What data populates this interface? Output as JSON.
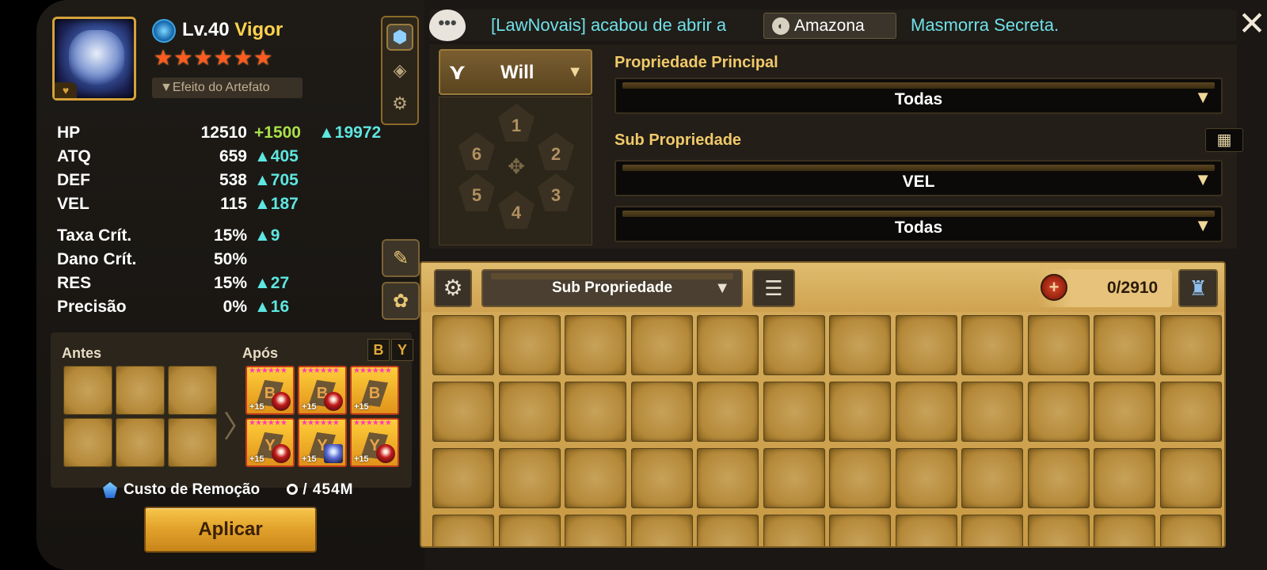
{
  "monster": {
    "level": "Lv.40",
    "name": "Vigor",
    "stars": "★★★★★★",
    "artifact_effect_label": "▼Efeito do Artefato"
  },
  "stats": [
    {
      "label": "HP",
      "base": "12510",
      "bonus": "+1500",
      "bonus2": "▲19972"
    },
    {
      "label": "ATQ",
      "base": "659",
      "bonus": "▲405"
    },
    {
      "label": "DEF",
      "base": "538",
      "bonus": "▲705"
    },
    {
      "label": "VEL",
      "base": "115",
      "bonus": "▲187"
    },
    {
      "label": "Taxa Crít.",
      "base": "15%",
      "bonus": "▲9"
    },
    {
      "label": "Dano Crít.",
      "base": "50%",
      "bonus": ""
    },
    {
      "label": "RES",
      "base": "15%",
      "bonus": "▲27"
    },
    {
      "label": "Precisão",
      "base": "0%",
      "bonus": "▲16"
    }
  ],
  "runes": {
    "before_label": "Antes",
    "after_label": "Após",
    "after_items": [
      {
        "stars": "★★★★★★",
        "level": "+15",
        "glyph": "B"
      },
      {
        "stars": "★★★★★★",
        "level": "+15",
        "glyph": "B"
      },
      {
        "stars": "★★★★★★",
        "level": "+15",
        "glyph": "B"
      },
      {
        "stars": "★★★★★★",
        "level": "+15",
        "glyph": "Y"
      },
      {
        "stars": "★★★★★★",
        "level": "+15",
        "glyph": "Y"
      },
      {
        "stars": "★★★★★★",
        "level": "+15",
        "glyph": "Y"
      }
    ],
    "set_icon_1": "B",
    "set_icon_2": "Y"
  },
  "removal": {
    "label": "Custo de Remoção",
    "value": " / 454M"
  },
  "apply_button": "Aplicar",
  "notification": {
    "chat_icon": "•••",
    "text1": "[LawNovais] acabou de abrir a",
    "tag": "Amazona",
    "text2": "Masmorra Secreta."
  },
  "close_label": "✕",
  "filter": {
    "set_name": "Will",
    "slots": [
      "1",
      "2",
      "3",
      "4",
      "5",
      "6"
    ],
    "main_prop_label": "Propriedade Principal",
    "main_prop_value": "Todas",
    "sub_prop_label": "Sub Propriedade",
    "sub_prop_value1": "VEL",
    "sub_prop_value2": "Todas"
  },
  "inventory": {
    "sort_label": "Sub Propriedade",
    "count": "0/2910"
  },
  "colors": {
    "accent_gold": "#f0c96a",
    "cyan_text": "#6fe0e8",
    "green_bonus": "#a9e04a",
    "star_orange": "#ff5a1f",
    "apply_button": "#e0a02a"
  }
}
